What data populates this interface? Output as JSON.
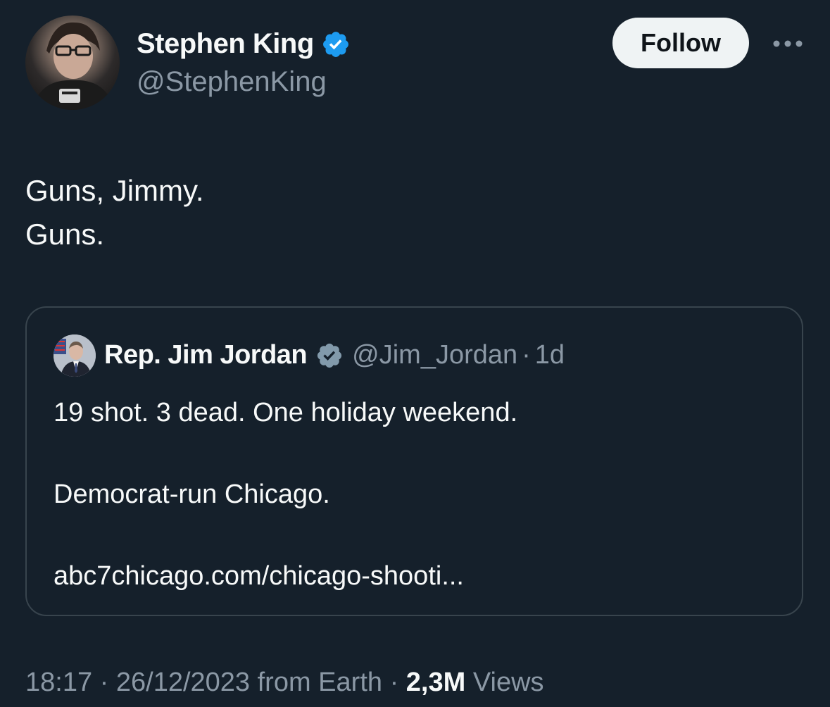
{
  "tweet": {
    "author": {
      "name": "Stephen King",
      "handle": "@StephenKing",
      "verified": true
    },
    "follow_label": "Follow",
    "more_label": "•••",
    "text_lines": [
      "Guns, Jimmy.",
      "Guns."
    ],
    "quoted": {
      "name": "Rep. Jim Jordan",
      "handle": "@Jim_Jordan",
      "separator": "·",
      "time": "1d",
      "verified_color": "#829aab",
      "paragraphs": [
        "19 shot. 3 dead. One holiday weekend.",
        "Democrat-run Chicago.",
        "abc7chicago.com/chicago-shooti..."
      ]
    },
    "meta": {
      "time": "18:17",
      "sep1": "·",
      "date": "26/12/2023",
      "source": "from Earth",
      "sep2": "·",
      "views_count": "2,3M",
      "views_label": "Views"
    }
  },
  "colors": {
    "background": "#15202b",
    "text": "#f7f9f9",
    "secondary": "#8b98a5",
    "verified_blue": "#1d9bf0",
    "border": "#38444d"
  },
  "icons": {
    "verified": "verified-badge-icon",
    "gov_verified": "gray-verified-badge-icon",
    "more": "more-dots-icon"
  }
}
